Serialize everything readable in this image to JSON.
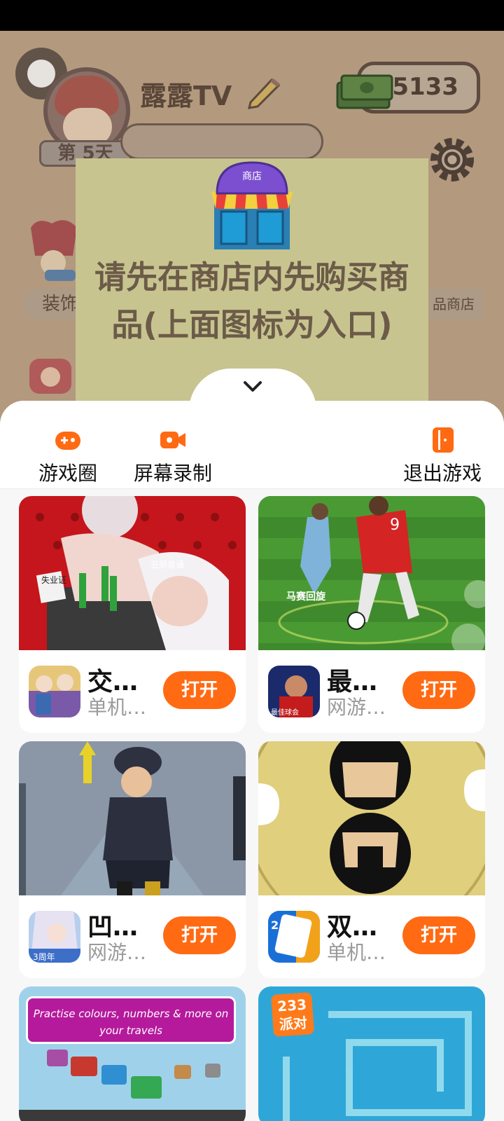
{
  "game": {
    "player_name": "露露TV",
    "day_label": "第 5天",
    "coins": "5133",
    "left_shop_label": "装饰",
    "right_shop_label": "品商店"
  },
  "popup": {
    "shop_sign": "商店",
    "message": "请先在商店内先购买商品(上面图标为入口)"
  },
  "toolbar": {
    "game_circle": "游戏圈",
    "screen_record": "屏幕录制",
    "exit_game": "退出游戏"
  },
  "cards": [
    {
      "title": "交…",
      "subtitle": "单机…",
      "button": "打开",
      "screenshot_text_1": "失业证",
      "screenshot_text_2": "丑陋普通"
    },
    {
      "title": "最…",
      "subtitle": "网游…",
      "button": "打开",
      "screenshot_text_1": "马赛回旋",
      "icon_text": "最佳球会"
    },
    {
      "title": "凹…",
      "subtitle": "网游…",
      "button": "打开",
      "icon_text": "3周年"
    },
    {
      "title": "双…",
      "subtitle": "单机…",
      "button": "打开"
    },
    {
      "banner": "Practise colours, numbers & more on your travels"
    },
    {
      "logo": "233派对"
    }
  ],
  "colors": {
    "accent": "#ff6a13",
    "popup_bg": "#c7c490",
    "game_bg": "#c7ad91"
  }
}
